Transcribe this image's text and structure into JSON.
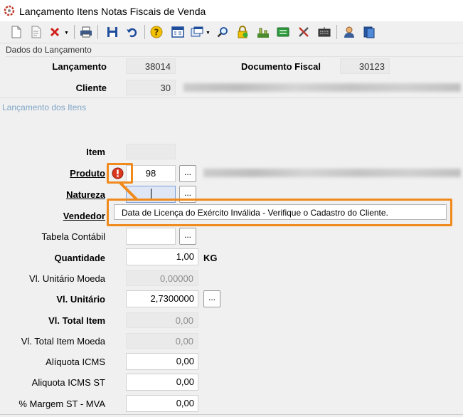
{
  "window": {
    "title": "Lançamento Itens Notas Fiscais de Venda"
  },
  "toolbar": {
    "icons": [
      "new-doc-icon",
      "edit-doc-icon",
      "delete-icon",
      "print-icon",
      "save-icon",
      "undo-icon",
      "help-icon",
      "calculator-icon",
      "window-icon",
      "search-icon",
      "lock-icon",
      "tree-icon",
      "money-icon",
      "tools-icon",
      "keyboard-icon",
      "user-icon",
      "book-icon"
    ]
  },
  "header_section": {
    "title": "Dados do Lançamento",
    "lancamento_label": "Lançamento",
    "lancamento_value": "38014",
    "documento_label": "Documento Fiscal",
    "documento_value": "30123",
    "cliente_label": "Cliente",
    "cliente_value": "30"
  },
  "items_section": {
    "title": "Lançamento dos Itens",
    "item_label": "Item",
    "item_value": "",
    "produto_label": "Produto",
    "produto_value": "98",
    "natureza_label": "Natureza",
    "natureza_value": "",
    "vendedor_label": "Vendedor",
    "tabela_label": "Tabela Contábil",
    "tabela_value": "",
    "quantidade_label": "Quantidade",
    "quantidade_value": "1,00",
    "quantidade_unit": "KG",
    "vl_unit_moeda_label": "Vl. Unitário Moeda",
    "vl_unit_moeda_value": "0,00000",
    "vl_unit_label": "Vl. Unitário",
    "vl_unit_value": "2,7300000",
    "vl_total_label": "Vl. Total Item",
    "vl_total_value": "0,00",
    "vl_total_moeda_label": "Vl. Total Item Moeda",
    "vl_total_moeda_value": "0,00",
    "aliq_icms_label": "Alíquota ICMS",
    "aliq_icms_value": "0,00",
    "aliq_icms_st_label": "Aliquota ICMS ST",
    "aliq_icms_st_value": "0,00",
    "margem_label": "% Margem ST - MVA",
    "margem_value": "0,00",
    "lookup_button": "..."
  },
  "tooltip": {
    "text": "Data de Licença do Exército Inválida - Verifique o Cadastro do Cliente."
  },
  "colors": {
    "highlight": "#f08a1c",
    "error": "#d9381e",
    "section_link": "#7fa5c8"
  }
}
